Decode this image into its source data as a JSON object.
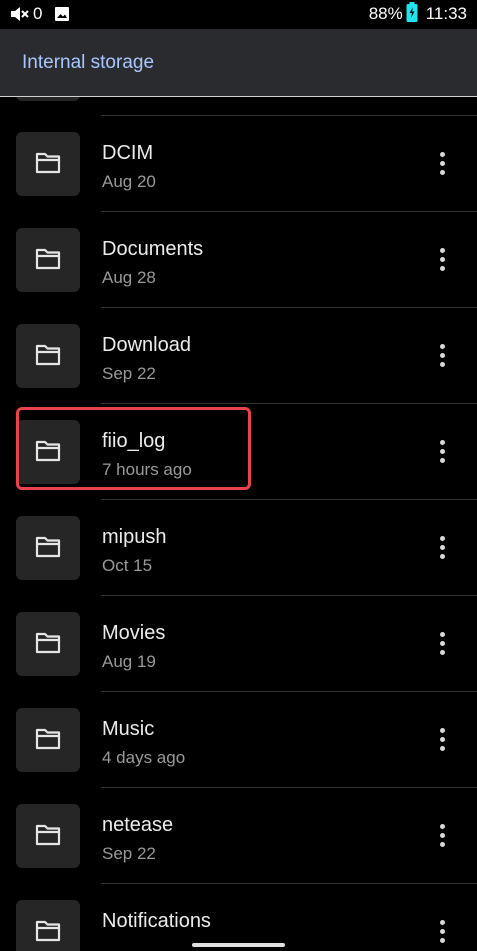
{
  "status_bar": {
    "notification_count": "0",
    "battery": "88%",
    "time": "11:33",
    "icons": [
      "mute-icon",
      "image-notification-icon",
      "battery-charging-icon"
    ]
  },
  "app_bar": {
    "title": "Internal storage"
  },
  "folders": [
    {
      "name": "DCIM",
      "date": "Aug 20",
      "icon": "folder-icon"
    },
    {
      "name": "Documents",
      "date": "Aug 28",
      "icon": "folder-icon"
    },
    {
      "name": "Download",
      "date": "Sep 22",
      "icon": "folder-icon"
    },
    {
      "name": "fiio_log",
      "date": "7 hours ago",
      "icon": "folder-icon",
      "highlighted": true
    },
    {
      "name": "mipush",
      "date": "Oct 15",
      "icon": "folder-icon"
    },
    {
      "name": "Movies",
      "date": "Aug 19",
      "icon": "folder-icon"
    },
    {
      "name": "Music",
      "date": "4 days ago",
      "icon": "folder-icon"
    },
    {
      "name": "netease",
      "date": "Sep 22",
      "icon": "folder-icon"
    },
    {
      "name": "Notifications",
      "date": "",
      "icon": "folder-icon"
    }
  ],
  "colors": {
    "background": "#000000",
    "app_bar": "#2a2b2e",
    "title_accent": "#a9c7ff",
    "highlight_border": "#e8434a"
  }
}
